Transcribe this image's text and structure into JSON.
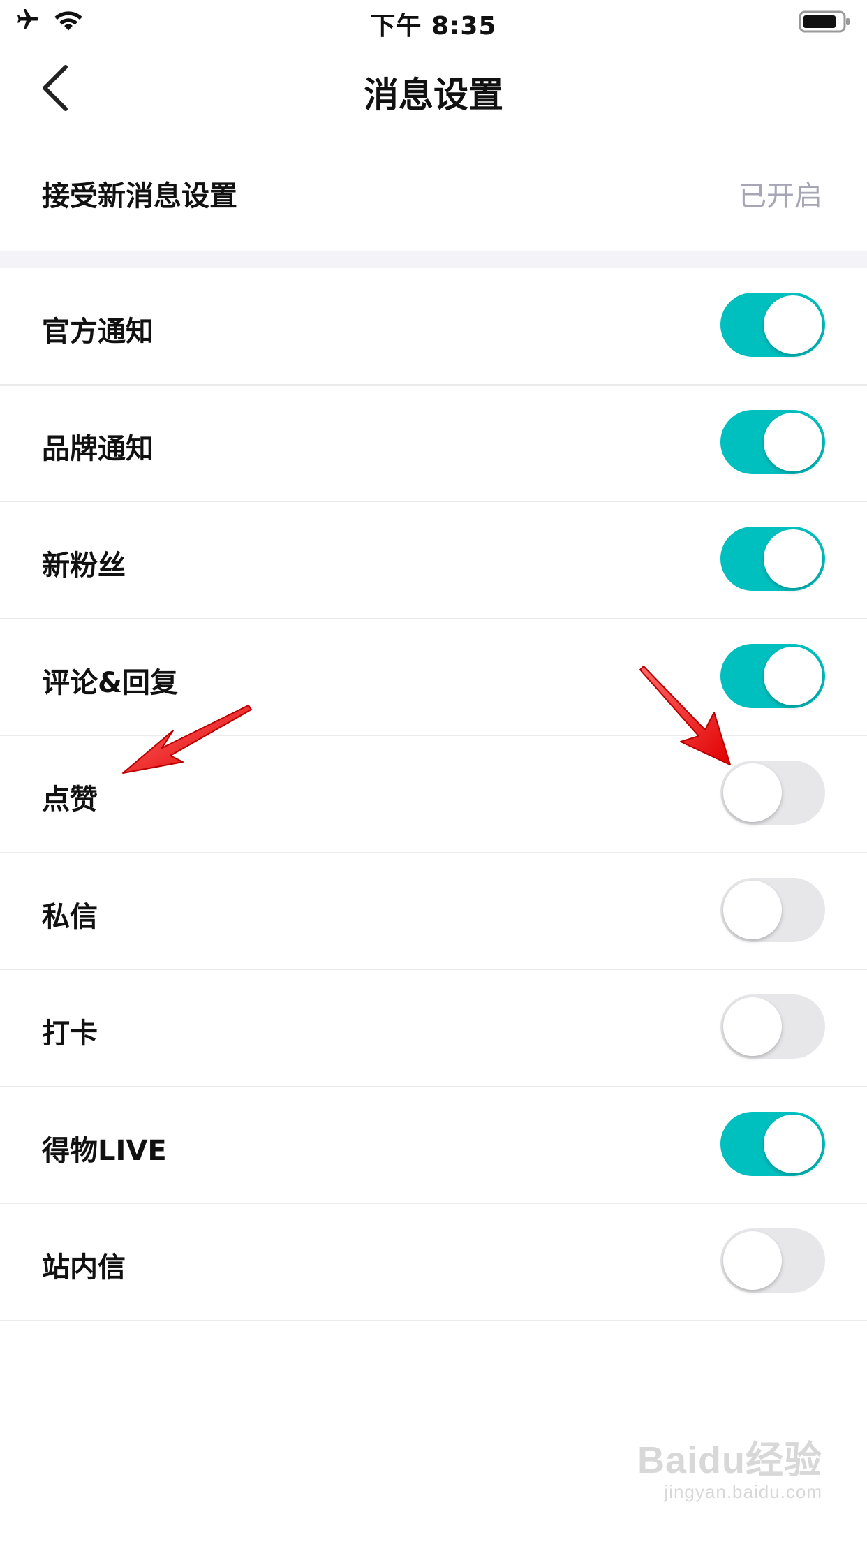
{
  "status_bar": {
    "time": "下午 8:35",
    "icons": [
      "airplane-icon",
      "wifi-icon",
      "battery-icon"
    ]
  },
  "nav": {
    "title": "消息设置",
    "back_icon": "chevron-left-icon"
  },
  "receive": {
    "label": "接受新消息设置",
    "status": "已开启"
  },
  "settings": [
    {
      "label": "官方通知",
      "on": true
    },
    {
      "label": "品牌通知",
      "on": true
    },
    {
      "label": "新粉丝",
      "on": true
    },
    {
      "label": "评论&回复",
      "on": true
    },
    {
      "label": "点赞",
      "on": false
    },
    {
      "label": "私信",
      "on": false
    },
    {
      "label": "打卡",
      "on": false
    },
    {
      "label": "得物LIVE",
      "on": true
    },
    {
      "label": "站内信",
      "on": false
    }
  ],
  "colors": {
    "toggle_on": "#00bfbf",
    "toggle_off": "#e7e7ea",
    "annotation_arrow": "#ff2020"
  },
  "watermark": {
    "main": "Baidu经验",
    "sub": "jingyan.baidu.com"
  }
}
